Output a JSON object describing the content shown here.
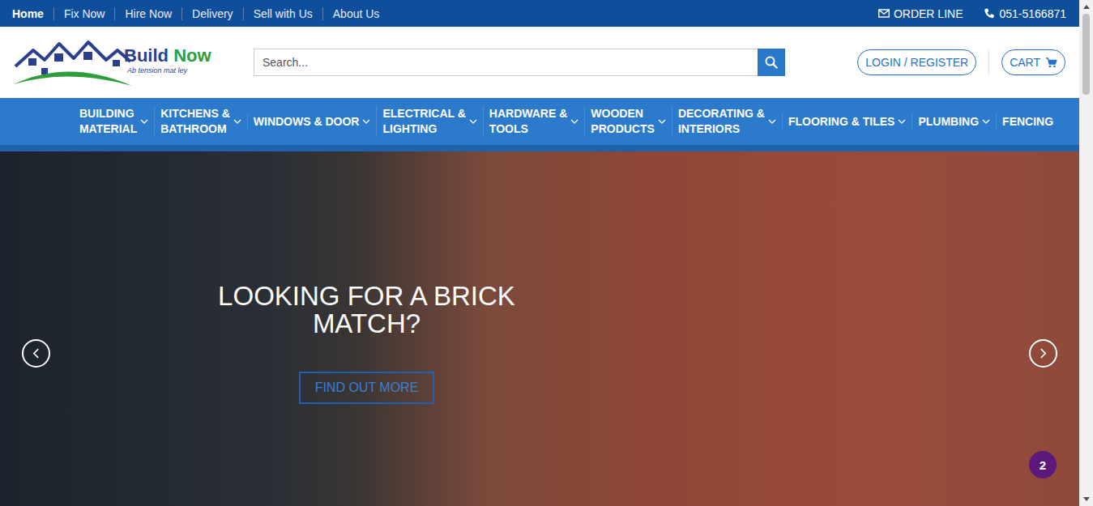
{
  "top_bar": {
    "links": [
      {
        "label": "Home",
        "selected": true
      },
      {
        "label": "Fix Now",
        "selected": false
      },
      {
        "label": "Hire Now",
        "selected": false
      },
      {
        "label": "Delivery",
        "selected": false
      },
      {
        "label": "Sell with Us",
        "selected": false
      },
      {
        "label": "About Us",
        "selected": false
      }
    ],
    "order_line": "ORDER LINE",
    "phone": "051-5166871"
  },
  "logo": {
    "name_first": "Build",
    "name_second": "Now",
    "tagline": "Ab tension mat ley"
  },
  "search": {
    "placeholder": "Search..."
  },
  "account": {
    "login": "LOGIN / REGISTER",
    "cart": "CART"
  },
  "nav": [
    {
      "lines": [
        "BUILDING",
        "MATERIAL"
      ],
      "dropdown": true
    },
    {
      "lines": [
        "KITCHENS &",
        "BATHROOM"
      ],
      "dropdown": true
    },
    {
      "lines": [
        "WINDOWS & DOOR"
      ],
      "dropdown": true
    },
    {
      "lines": [
        "ELECTRICAL &",
        "LIGHTING"
      ],
      "dropdown": true
    },
    {
      "lines": [
        "HARDWARE &",
        "TOOLS"
      ],
      "dropdown": true
    },
    {
      "lines": [
        "WOODEN",
        "PRODUCTS"
      ],
      "dropdown": true
    },
    {
      "lines": [
        "DECORATING &",
        "INTERIORS"
      ],
      "dropdown": true
    },
    {
      "lines": [
        "FLOORING & TILES"
      ],
      "dropdown": true
    },
    {
      "lines": [
        "PLUMBING"
      ],
      "dropdown": true
    },
    {
      "lines": [
        "FENCING"
      ],
      "dropdown": false
    }
  ],
  "hero": {
    "title": "LOOKING FOR A BRICK MATCH?",
    "button": "FIND OUT MORE"
  },
  "badge": {
    "count": "2"
  }
}
